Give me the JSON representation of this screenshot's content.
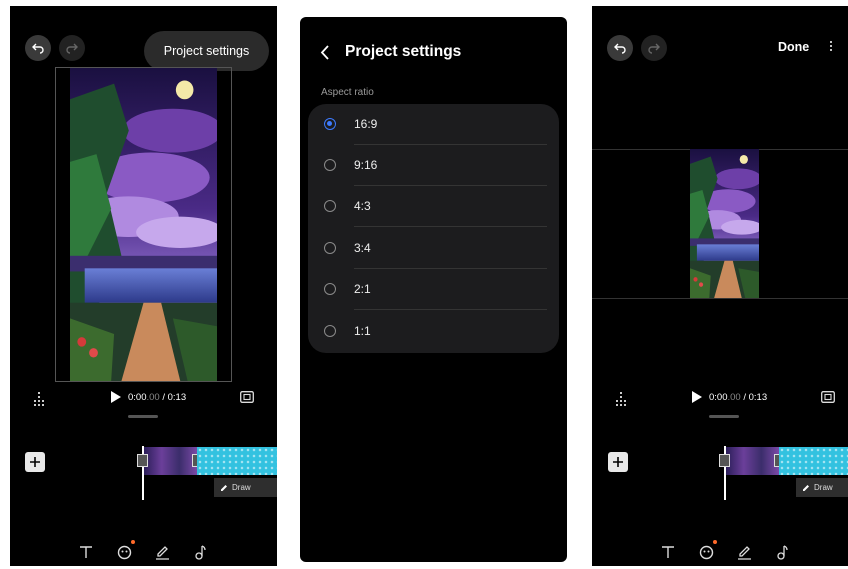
{
  "editor": {
    "undo_icon": "undo-icon",
    "redo_icon": "redo-icon",
    "project_settings_label": "Project settings",
    "time_current": "0:00",
    "time_fraction": ".00",
    "time_total": "/ 0:13",
    "draw_label": "Draw",
    "tools": [
      "text-icon",
      "sticker-icon",
      "pen-icon",
      "music-icon"
    ]
  },
  "settings": {
    "title": "Project settings",
    "section_label": "Aspect ratio",
    "options": [
      {
        "label": "16:9",
        "selected": true
      },
      {
        "label": "9:16",
        "selected": false
      },
      {
        "label": "4:3",
        "selected": false
      },
      {
        "label": "3:4",
        "selected": false
      },
      {
        "label": "2:1",
        "selected": false
      },
      {
        "label": "1:1",
        "selected": false
      }
    ],
    "accent_color": "#3d7bff"
  },
  "editor_16_9": {
    "done_label": "Done",
    "time_current": "0:00",
    "time_fraction": ".00",
    "time_total": "/ 0:13",
    "draw_label": "Draw"
  }
}
